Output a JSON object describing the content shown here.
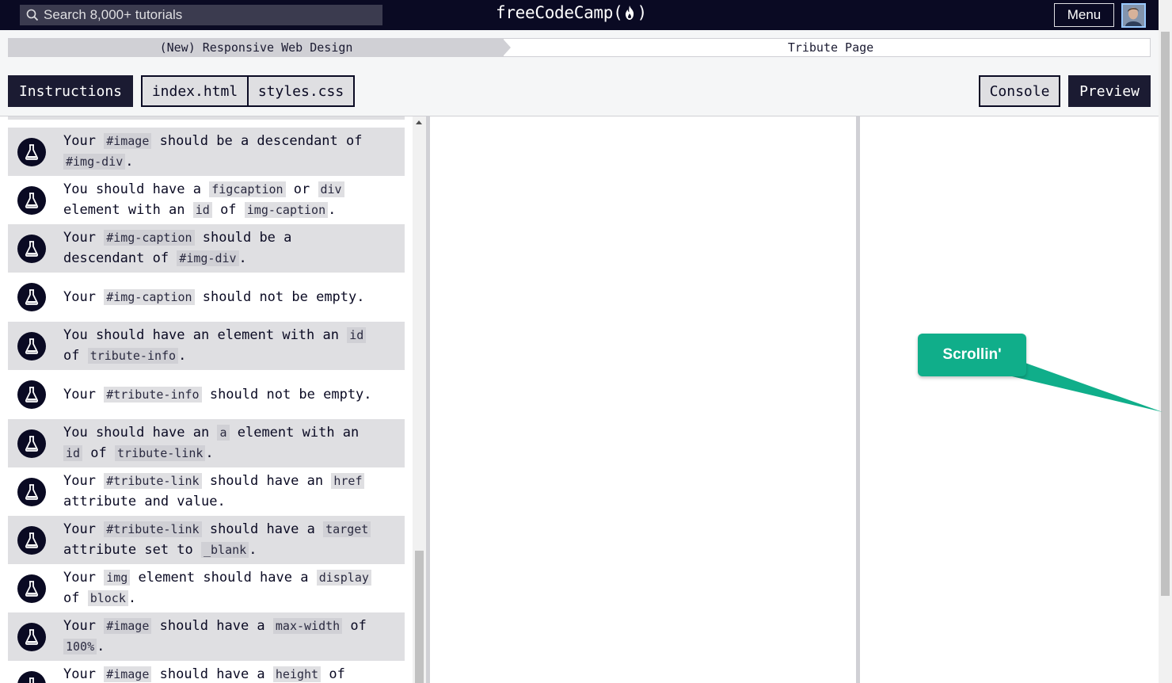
{
  "nav": {
    "search_placeholder": "Search 8,000+ tutorials",
    "logo_left": "freeCodeCamp(",
    "logo_right": ")",
    "menu_label": "Menu"
  },
  "breadcrumb": {
    "course": "(New) Responsive Web Design",
    "project": "Tribute Page"
  },
  "tabs": {
    "instructions": "Instructions",
    "file1": "index.html",
    "file2": "styles.css",
    "console": "Console",
    "preview": "Preview"
  },
  "tests": [
    {
      "segments": [
        {
          "t": "Your "
        },
        {
          "c": "#image"
        },
        {
          "t": " should be a descendant of"
        },
        {
          "br": true
        },
        {
          "c": "#img-div"
        },
        {
          "t": "."
        }
      ]
    },
    {
      "segments": [
        {
          "t": "You should have a "
        },
        {
          "c": "figcaption"
        },
        {
          "t": " or "
        },
        {
          "c": "div"
        },
        {
          "br": true
        },
        {
          "t": "element with an "
        },
        {
          "c": "id"
        },
        {
          "t": " of "
        },
        {
          "c": "img-caption"
        },
        {
          "t": "."
        }
      ]
    },
    {
      "segments": [
        {
          "t": "Your "
        },
        {
          "c": "#img-caption"
        },
        {
          "t": " should be a"
        },
        {
          "br": true
        },
        {
          "t": "descendant of "
        },
        {
          "c": "#img-div"
        },
        {
          "t": "."
        }
      ]
    },
    {
      "segments": [
        {
          "t": "Your "
        },
        {
          "c": "#img-caption"
        },
        {
          "t": " should not be empty."
        }
      ]
    },
    {
      "segments": [
        {
          "t": "You should have an element with an "
        },
        {
          "c": "id"
        },
        {
          "br": true
        },
        {
          "t": "of "
        },
        {
          "c": "tribute-info"
        },
        {
          "t": "."
        }
      ]
    },
    {
      "segments": [
        {
          "t": "Your "
        },
        {
          "c": "#tribute-info"
        },
        {
          "t": " should not be empty."
        }
      ]
    },
    {
      "segments": [
        {
          "t": "You should have an "
        },
        {
          "c": "a"
        },
        {
          "t": " element with an"
        },
        {
          "br": true
        },
        {
          "c": "id"
        },
        {
          "t": " of "
        },
        {
          "c": "tribute-link"
        },
        {
          "t": "."
        }
      ]
    },
    {
      "segments": [
        {
          "t": "Your "
        },
        {
          "c": "#tribute-link"
        },
        {
          "t": " should have an "
        },
        {
          "c": "href"
        },
        {
          "br": true
        },
        {
          "t": "attribute and value."
        }
      ]
    },
    {
      "segments": [
        {
          "t": "Your "
        },
        {
          "c": "#tribute-link"
        },
        {
          "t": " should have a "
        },
        {
          "c": "target"
        },
        {
          "br": true
        },
        {
          "t": "attribute set to "
        },
        {
          "c": "_blank"
        },
        {
          "t": "."
        }
      ]
    },
    {
      "segments": [
        {
          "t": "Your "
        },
        {
          "c": "img"
        },
        {
          "t": " element should have a "
        },
        {
          "c": "display"
        },
        {
          "br": true
        },
        {
          "t": "of "
        },
        {
          "c": "block"
        },
        {
          "t": "."
        }
      ]
    },
    {
      "segments": [
        {
          "t": "Your "
        },
        {
          "c": "#image"
        },
        {
          "t": " should have a "
        },
        {
          "c": "max-width"
        },
        {
          "t": " of"
        },
        {
          "br": true
        },
        {
          "c": "100%"
        },
        {
          "t": "."
        }
      ]
    },
    {
      "segments": [
        {
          "t": "Your "
        },
        {
          "c": "#image"
        },
        {
          "t": " should have a "
        },
        {
          "c": "height"
        },
        {
          "t": " of"
        }
      ]
    }
  ],
  "callout": {
    "label": "Scrollin'"
  }
}
